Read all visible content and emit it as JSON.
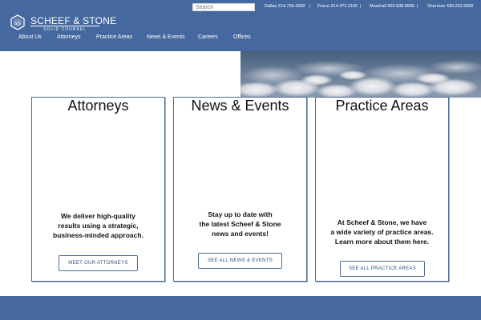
{
  "brand": {
    "name": "SCHEEF & STONE",
    "tagline": "SOLID COUNSEL"
  },
  "search": {
    "placeholder": "Search"
  },
  "offices": [
    {
      "label": "Dallas 214.706.4200"
    },
    {
      "label": "Frisco 214.472.2100"
    },
    {
      "label": "Marshall 903.938.8900"
    },
    {
      "label": "Sherman 430.262.5660"
    }
  ],
  "separator": "|",
  "nav": [
    {
      "label": "About Us"
    },
    {
      "label": "Attorneys"
    },
    {
      "label": "Practice Areas"
    },
    {
      "label": "News & Events"
    },
    {
      "label": "Careers"
    },
    {
      "label": "Offices"
    }
  ],
  "cards": [
    {
      "title": "Attorneys",
      "lines": [
        "We deliver high-quality",
        "results using a strategic,",
        "business-minded approach."
      ],
      "button": "MEET OUR ATTORNEYS"
    },
    {
      "title": "News & Events",
      "lines": [
        "Stay up to date with",
        "the latest Scheef & Stone",
        "news and events!"
      ],
      "button": "SEE ALL NEWS & EVENTS"
    },
    {
      "title": "Practice Areas",
      "lines": [
        "At Scheef & Stone, we have",
        "a wide variety of practice areas.",
        "Learn more about them here."
      ],
      "button": "SEE ALL PRACTICE AREAS"
    }
  ],
  "colors": {
    "header": "#45699f",
    "card_border": "#4e6e98",
    "button_text": "#2f4f7f"
  },
  "icons": {
    "logo": "scheef-stone-logo-icon"
  }
}
